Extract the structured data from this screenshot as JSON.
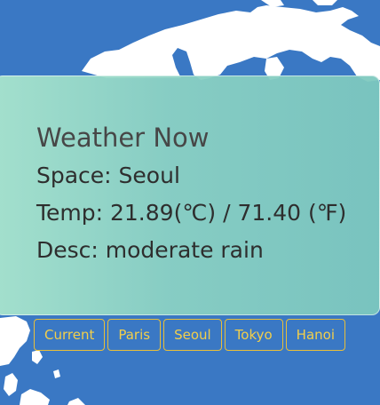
{
  "weather": {
    "title": "Weather Now",
    "space": "Space: Seoul",
    "temp": "Temp: 21.89(℃) / 71.40 (℉)",
    "desc": "Desc: moderate rain"
  },
  "buttons": [
    "Current",
    "Paris",
    "Seoul",
    "Tokyo",
    "Hanoi"
  ],
  "colors": {
    "sea": "#3a78c4",
    "land": "#ffffff",
    "card": "#8fd3c3",
    "button_accent": "#e8bf3a"
  }
}
